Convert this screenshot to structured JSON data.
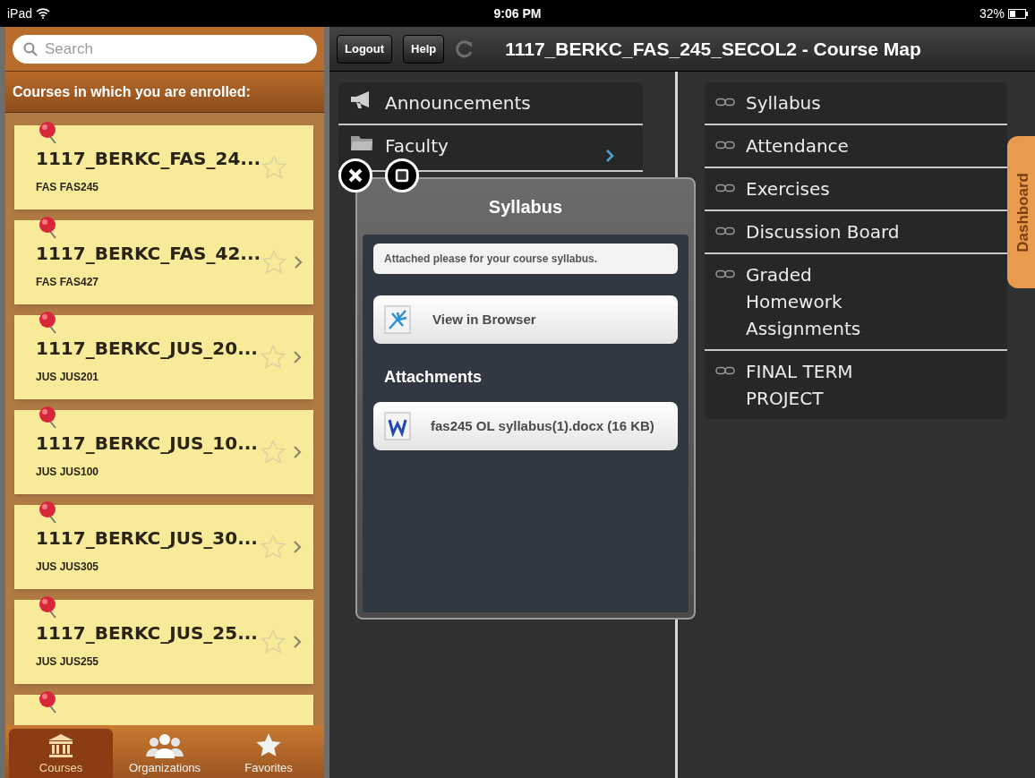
{
  "status_bar": {
    "device": "iPad",
    "time": "9:06 PM",
    "battery": "32%"
  },
  "sidebar": {
    "search": {
      "placeholder": "Search"
    },
    "header": "Courses in which you are enrolled:",
    "courses": [
      {
        "title": "1117_BERKC_FAS_24...",
        "code": "FAS FAS245",
        "favorite": false,
        "disclosure": false
      },
      {
        "title": "1117_BERKC_FAS_42...",
        "code": "FAS FAS427",
        "favorite": false,
        "disclosure": true
      },
      {
        "title": "1117_BERKC_JUS_20...",
        "code": "JUS JUS201",
        "favorite": false,
        "disclosure": true
      },
      {
        "title": "1117_BERKC_JUS_10...",
        "code": "JUS JUS100",
        "favorite": false,
        "disclosure": true
      },
      {
        "title": "1117_BERKC_JUS_30...",
        "code": "JUS JUS305",
        "favorite": false,
        "disclosure": true
      },
      {
        "title": "1117_BERKC_JUS_25...",
        "code": "JUS JUS255",
        "favorite": false,
        "disclosure": true
      }
    ],
    "tabs": [
      {
        "label": "Courses",
        "kind": "courses",
        "selected": true
      },
      {
        "label": "Organizations",
        "kind": "organizations",
        "selected": false
      },
      {
        "label": "Favorites",
        "kind": "favorites",
        "selected": false
      }
    ]
  },
  "toolbar": {
    "buttons": [
      "Logout",
      "Help"
    ],
    "title": "1117_BERKC_FAS_245_SECOL2 - Course Map"
  },
  "course_map": {
    "left_items": [
      {
        "label": "Announcements",
        "kind": "announcement",
        "disclosure": false
      },
      {
        "label": "Faculty",
        "kind": "folder",
        "disclosure": true
      }
    ],
    "right_items": [
      "Syllabus",
      "Attendance",
      "Exercises",
      "Discussion Board",
      "Graded Homework Assignments",
      "FINAL TERM PROJECT"
    ],
    "side_tab": "Dashboard"
  },
  "popup": {
    "title": "Syllabus",
    "message": "Attached please for your course syllabus.",
    "actions": [
      {
        "label": "View in Browser",
        "kind": "browser"
      }
    ],
    "section": "Attachments",
    "attachments": [
      {
        "label": "fas245 OL syllabus(1).docx (16 KB)",
        "kind": "word"
      }
    ]
  }
}
